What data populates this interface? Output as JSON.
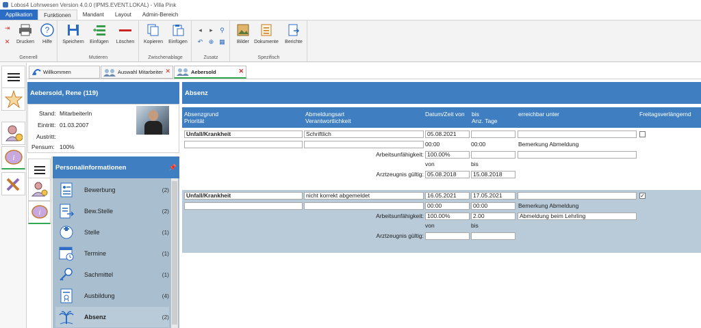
{
  "window": {
    "title": "Lobos4 Lohnwesen Version 4.0.0 (IPMS.EVENT.LOKAL) - Villa Pink"
  },
  "menu": {
    "tabs": [
      "Applikation",
      "Funktionen",
      "Mandant",
      "Layout",
      "Admin-Bereich"
    ]
  },
  "ribbon": {
    "buttons": {
      "print": "Drucken",
      "help": "Hilfe",
      "save": "Speichern",
      "insert": "Einfügen",
      "delete": "Löschen",
      "copy": "Kopieren",
      "paste": "Einfügen",
      "images": "Bilder",
      "documents": "Dokumente",
      "reports": "Berichte"
    },
    "groups": {
      "general": "Generell",
      "mutate": "Mutieren",
      "clipboard": "Zwischenablage",
      "extra": "Zusatz",
      "specific": "Spezifisch"
    }
  },
  "doc_tabs": {
    "welcome": "Willkommen",
    "selection": "Auswahl Mitarbeiter",
    "person": "Aebersold"
  },
  "person": {
    "header": "Aebersold, Rene (119)",
    "stand_label": "Stand:",
    "stand_value": "MitarbeiterIn",
    "eintritt_label": "Eintritt:",
    "eintritt_value": "01.03.2007",
    "austritt_label": "Austritt:",
    "austritt_value": "",
    "pensum_label": "Pensum:",
    "pensum_value": "100%"
  },
  "personal_info": {
    "title": "Personalinformationen",
    "items": [
      {
        "label": "Bewerbung",
        "count": "(2)"
      },
      {
        "label": "Bew.Stelle",
        "count": "(2)"
      },
      {
        "label": "Stelle",
        "count": "(1)"
      },
      {
        "label": "Termine",
        "count": "(1)"
      },
      {
        "label": "Sachmittel",
        "count": "(1)"
      },
      {
        "label": "Ausbildung",
        "count": "(4)"
      },
      {
        "label": "Absenz",
        "count": "(2)"
      }
    ]
  },
  "absenz": {
    "title": "Absenz",
    "columns": {
      "grund": "Absenzgrund",
      "prioritaet": "Priorität",
      "art": "Abmeldungsart",
      "verantwortlich": "Verantwortlichkeit",
      "datum": "Datum/Zeit von",
      "bis": "bis",
      "tage": "Anz. Tage",
      "erreichbar": "erreichbar unter",
      "freitag": "Freitagsverlängernd"
    },
    "labels": {
      "arbeitsunfaehigkeit": "Arbeitsunfähigkeit:",
      "von": "von",
      "bis": "bis",
      "arztzeugnis": "Arztzeugnis gültig:",
      "bemerkung": "Bemerkung Abmeldung"
    },
    "records": [
      {
        "grund": "Unfall/Krankheit",
        "art": "Schriftlich",
        "von": "05.08.2021",
        "bis": "",
        "erreichbar": "",
        "prioritaet": "",
        "verantwortlich": "",
        "zeit_von": "00:00",
        "zeit_bis": "00:00",
        "arbeitsunfaehigkeit": "100.00%",
        "anz_tage": "",
        "bemerkung": "",
        "zeugnis_von": "05.08.2018",
        "zeugnis_bis": "15.08.2018",
        "freitag_checked": "false"
      },
      {
        "grund": "Unfall/Krankheit",
        "art": "nicht korrekt abgemeldet",
        "von": "16.05.2021",
        "bis": "17.05.2021",
        "erreichbar": "",
        "prioritaet": "",
        "verantwortlich": "",
        "zeit_von": "00:00",
        "zeit_bis": "00:00",
        "arbeitsunfaehigkeit": "100.00%",
        "anz_tage": "2.00",
        "bemerkung": "Abmeldung beim Lehrling",
        "zeugnis_von": "",
        "zeugnis_bis": "",
        "freitag_checked": "true",
        "checkmark": "✓"
      }
    ]
  }
}
